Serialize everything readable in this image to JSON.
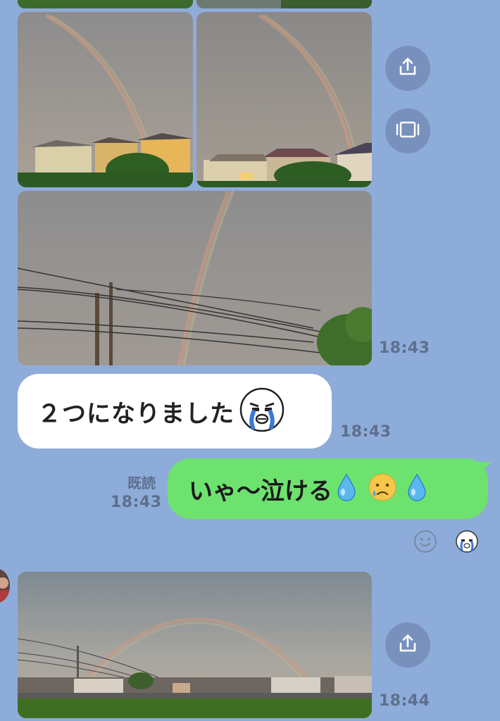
{
  "messages": {
    "photo_group_time": "18:43",
    "text_message": "２つになりました",
    "text_message_time": "18:43",
    "reply_message": "いゃ〜泣ける",
    "reply_read_label": "既読",
    "reply_time": "18:43",
    "panorama_time": "18:44"
  },
  "icons": {
    "share": "share-icon",
    "slideshow": "slideshow-icon",
    "reaction": "smiley-icon",
    "sticker_crying": "crying-face-icon",
    "droplet": "droplet-icon",
    "sad_face": "sad-face-emoji"
  },
  "colors": {
    "background": "#8eacd9",
    "own_bubble": "#6ee26e",
    "other_bubble": "#ffffff",
    "timestamp": "#5d6f8c"
  }
}
